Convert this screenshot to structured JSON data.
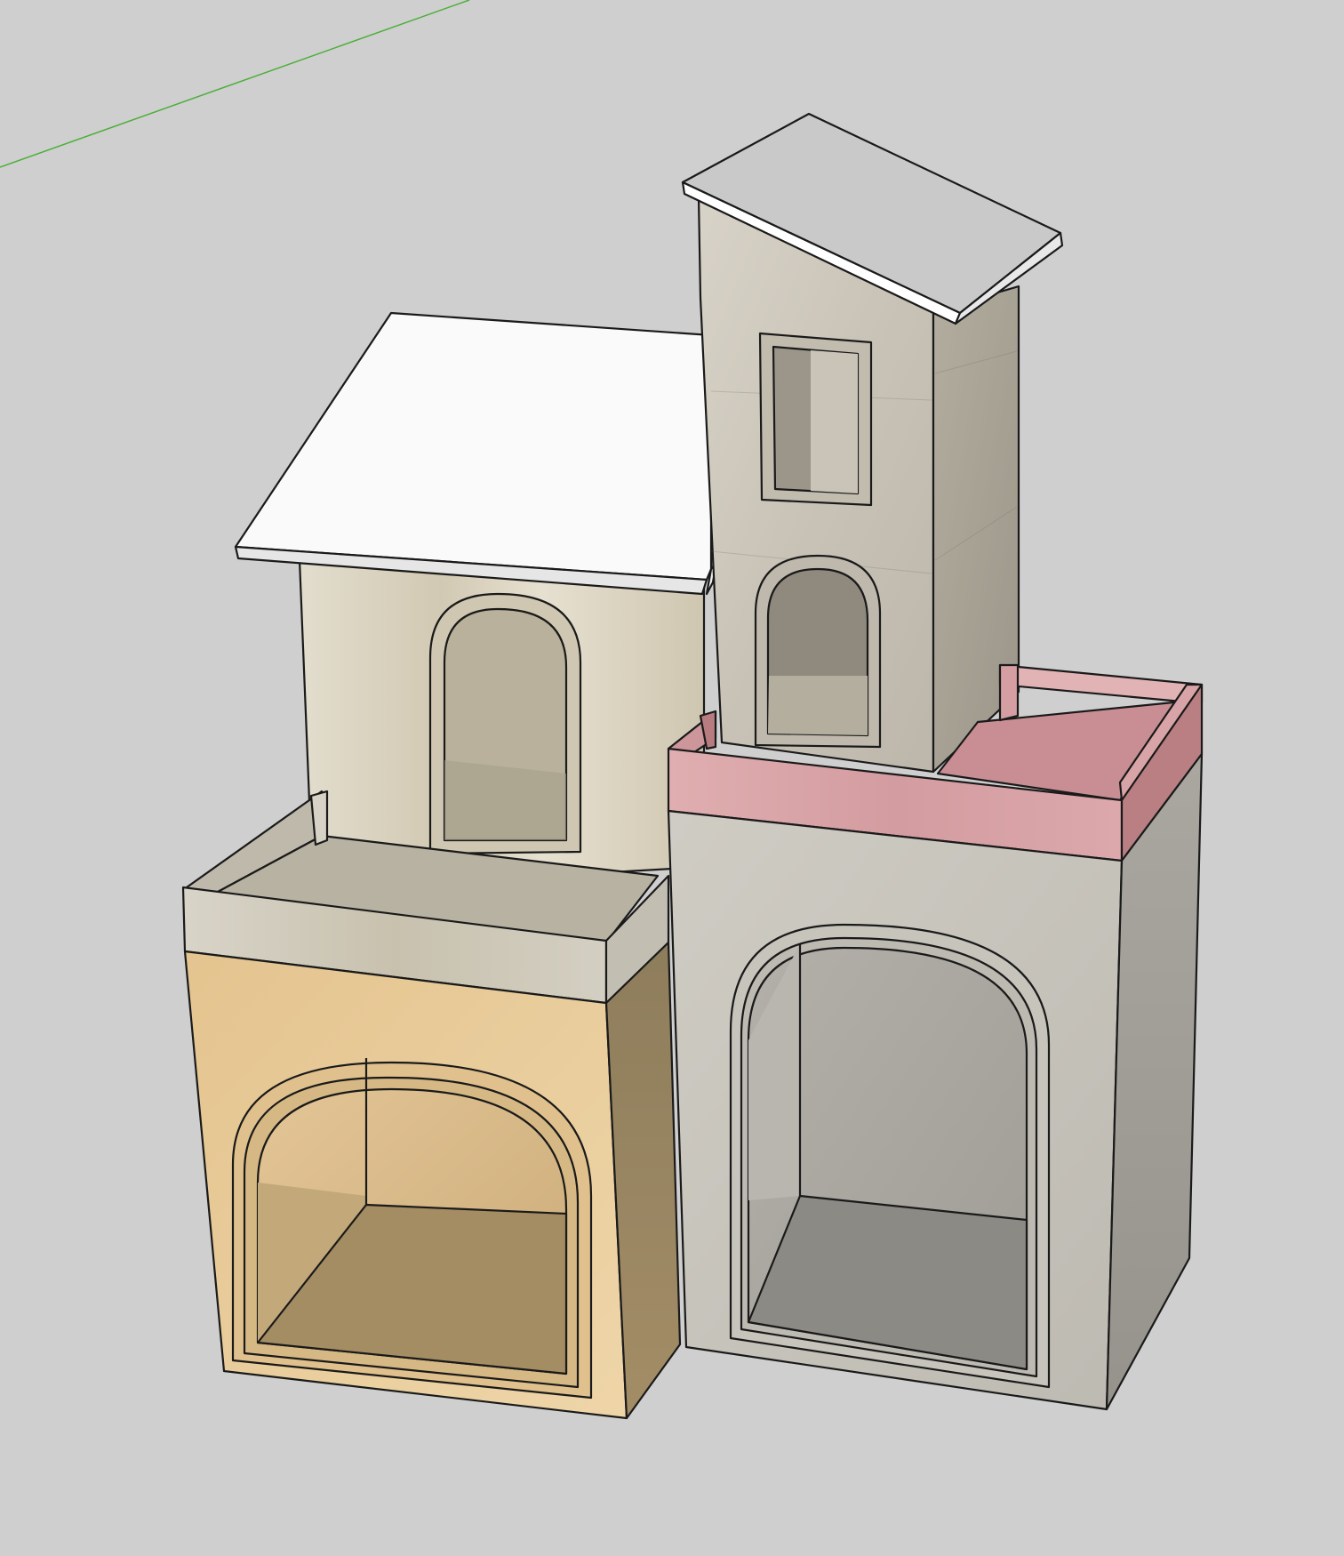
{
  "viewport": {
    "background": "#cfcfcf",
    "green_axis_color": "#4caf3a"
  },
  "colors": {
    "roof_white": "#f4f4f4",
    "roof_top_grey": "#cbcbcb",
    "roof_edge_light": "#ffffff",
    "tower_stone": "#cdc8bd",
    "tower_stone_dark": "#a9a49a",
    "upper_house_cream": "#dcd6c6",
    "upper_house_shade": "#c3b9a3",
    "left_box_tan": "#e5c997",
    "left_box_tan_dark": "#8b7a5a",
    "left_box_interior": "#b49a70",
    "left_parapet": "#cfcabe",
    "right_box_grey": "#c6c3bb",
    "right_box_grey_dark": "#9f9c95",
    "right_interior": "#a9a7a1",
    "right_interior_floor": "#8f8d88",
    "pink_band": "#d8a2a4",
    "pink_dark": "#b87c80"
  },
  "model": {
    "components": [
      {
        "id": "tower",
        "icon": "stone-tower-icon"
      },
      {
        "id": "tower-roof",
        "icon": "slab-roof-icon"
      },
      {
        "id": "upper-house",
        "icon": "house-icon"
      },
      {
        "id": "upper-roof",
        "icon": "slab-roof-icon"
      },
      {
        "id": "left-box",
        "icon": "arched-box-icon"
      },
      {
        "id": "right-box",
        "icon": "arched-box-icon"
      }
    ]
  }
}
